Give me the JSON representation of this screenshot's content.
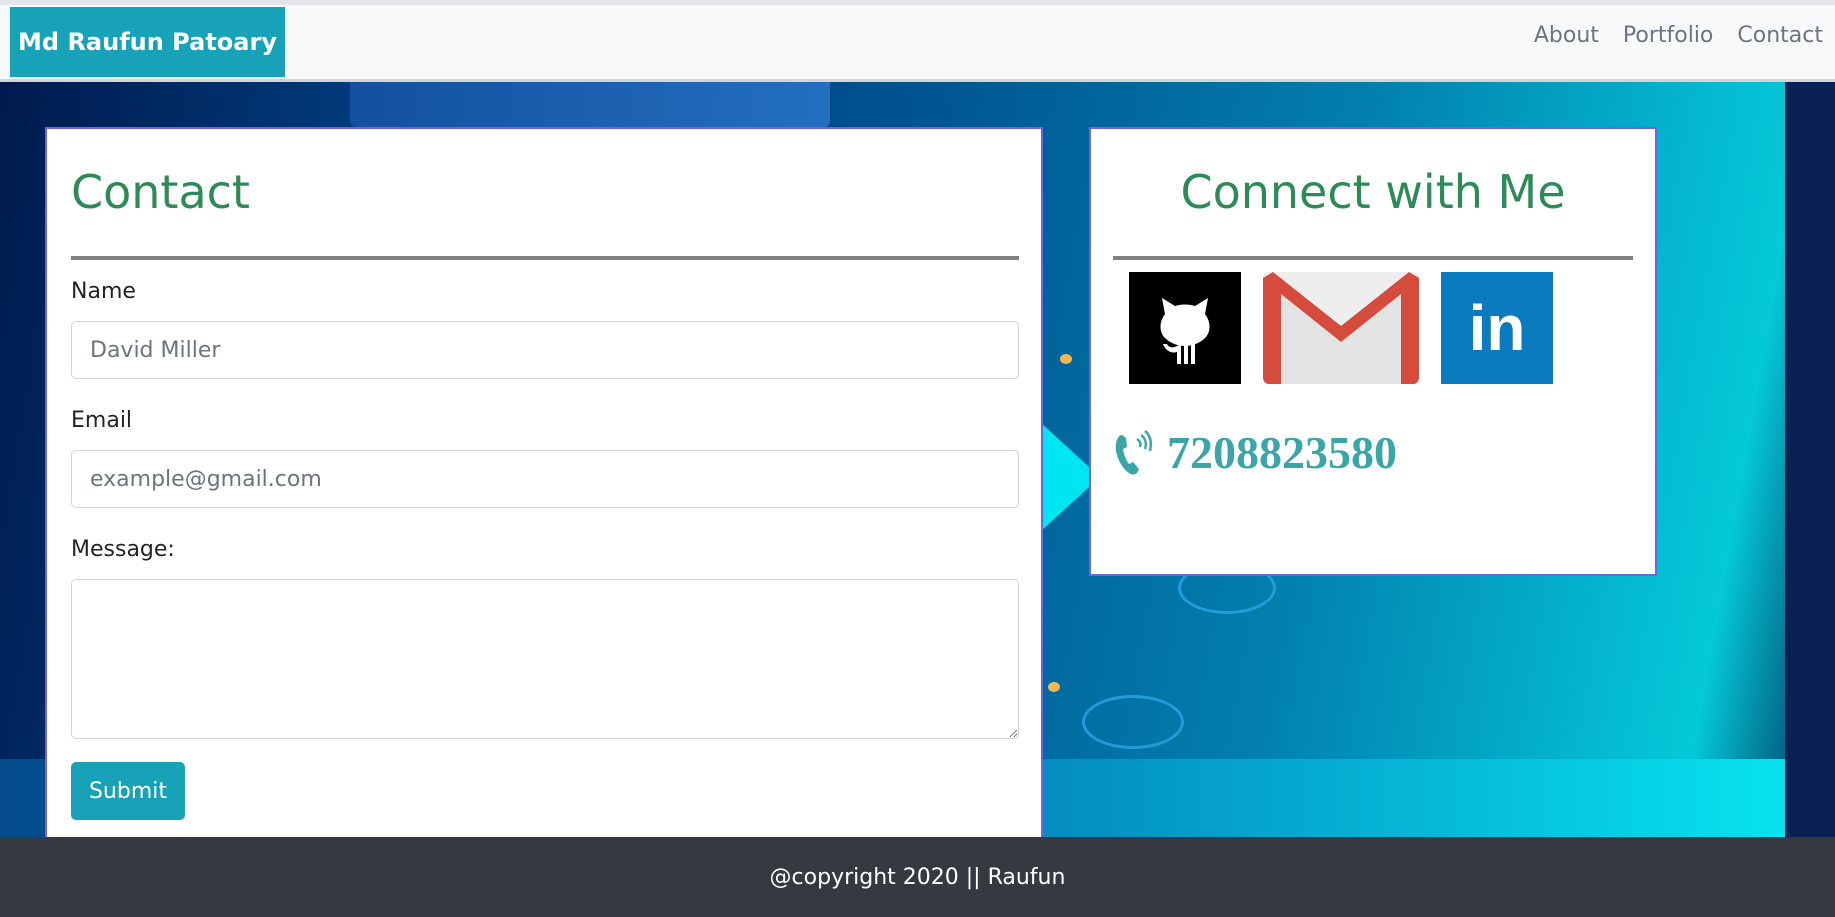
{
  "navbar": {
    "brand": "Md Raufun Patoary",
    "links": [
      "About",
      "Portfolio",
      "Contact"
    ]
  },
  "contact_form": {
    "title": "Contact",
    "name_label": "Name",
    "name_placeholder": "David Miller",
    "email_label": "Email",
    "email_placeholder": "example@gmail.com",
    "message_label": "Message:",
    "submit_label": "Submit"
  },
  "connect": {
    "title": "Connect with Me",
    "socials": [
      "github-icon",
      "gmail-icon",
      "linkedin-icon"
    ],
    "linkedin_text": "in",
    "phone": "7208823580"
  },
  "footer": {
    "text": "@copyright 2020 || Raufun"
  },
  "colors": {
    "brand": "#17a2b8",
    "title_green": "#2e8b57",
    "phone_teal": "#3aa6a8",
    "footer_bg": "#343a40"
  }
}
